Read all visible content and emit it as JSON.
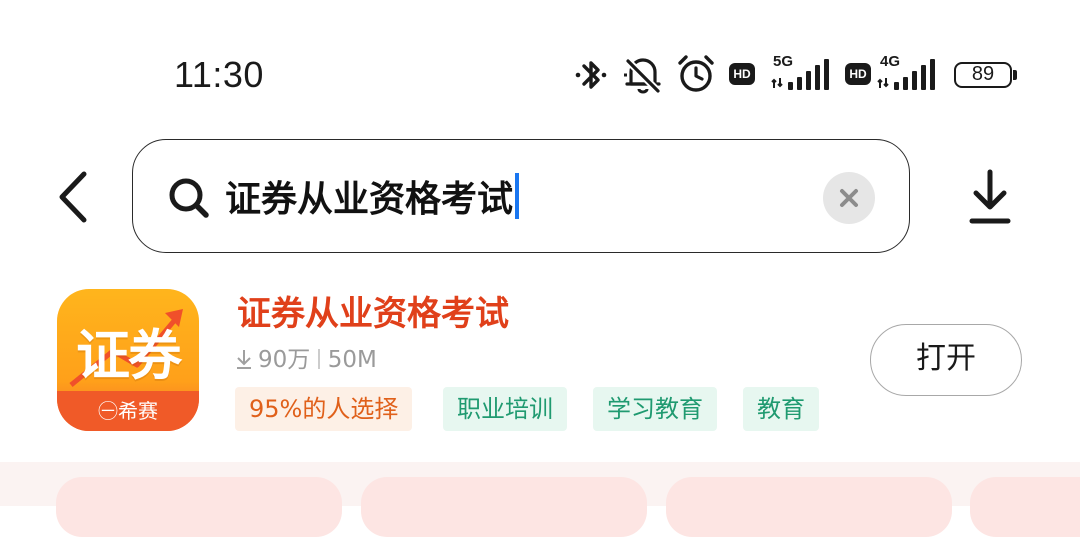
{
  "status_bar": {
    "time": "11:30",
    "icons": [
      "bluetooth-icon",
      "silent-icon",
      "alarm-icon",
      "hd-icon",
      "signal-5g-icon",
      "hd-icon",
      "signal-4g-icon",
      "battery-icon"
    ],
    "hd_label": "HD",
    "net1": "5G",
    "net2": "4G",
    "battery": "89"
  },
  "search": {
    "query": "证券从业资格考试"
  },
  "app": {
    "name": "证券从业资格考试",
    "icon_text": "证券",
    "icon_brand": "㊀希赛",
    "downloads": "90万",
    "size": "50M",
    "tags": [
      {
        "label": "95%的人选择",
        "style": "orange"
      },
      {
        "label": "职业培训",
        "style": "green"
      },
      {
        "label": "学习教育",
        "style": "green"
      },
      {
        "label": "教育",
        "style": "green"
      }
    ],
    "open_label": "打开"
  },
  "colors": {
    "accent_red": "#e0401a",
    "caret_blue": "#1976f0",
    "tag_green_text": "#1f9a70",
    "tag_orange_text": "#e0601a"
  }
}
